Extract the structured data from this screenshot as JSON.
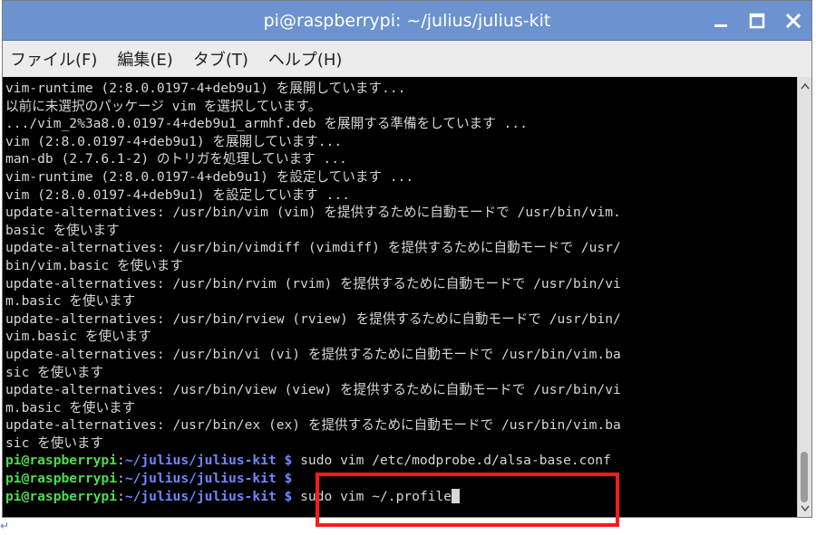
{
  "window": {
    "title": "pi@raspberrypi: ~/julius/julius-kit"
  },
  "window_controls": [
    {
      "name": "minimize-icon",
      "glyph": "minimize"
    },
    {
      "name": "maximize-icon",
      "glyph": "maximize"
    },
    {
      "name": "close-icon",
      "glyph": "close"
    }
  ],
  "menu": {
    "file": "ファイル(F)",
    "edit": "編集(E)",
    "tabs": "タブ(T)",
    "help": "ヘルプ(H)"
  },
  "terminal": {
    "output_lines": [
      "vim-runtime (2:8.0.0197-4+deb9u1) を展開しています...",
      "以前に未選択のパッケージ vim を選択しています。",
      ".../vim_2%3a8.0.0197-4+deb9u1_armhf.deb を展開する準備をしています ...",
      "vim (2:8.0.0197-4+deb9u1) を展開しています...",
      "man-db (2.7.6.1-2) のトリガを処理しています ...",
      "vim-runtime (2:8.0.0197-4+deb9u1) を設定しています ...",
      "vim (2:8.0.0197-4+deb9u1) を設定しています ...",
      "update-alternatives: /usr/bin/vim (vim) を提供するために自動モードで /usr/bin/vim.",
      "basic を使います",
      "update-alternatives: /usr/bin/vimdiff (vimdiff) を提供するために自動モードで /usr/",
      "bin/vim.basic を使います",
      "update-alternatives: /usr/bin/rvim (rvim) を提供するために自動モードで /usr/bin/vi",
      "m.basic を使います",
      "update-alternatives: /usr/bin/rview (rview) を提供するために自動モードで /usr/bin/",
      "vim.basic を使います",
      "update-alternatives: /usr/bin/vi (vi) を提供するために自動モードで /usr/bin/vim.ba",
      "sic を使います",
      "update-alternatives: /usr/bin/view (view) を提供するために自動モードで /usr/bin/vi",
      "m.basic を使います",
      "update-alternatives: /usr/bin/ex (ex) を提供するために自動モードで /usr/bin/vim.ba",
      "sic を使います"
    ],
    "prompt_user": "pi@raspberrypi",
    "prompt_colon": ":",
    "prompt_path": "~/julius/julius-kit",
    "prompt_dollar": "$",
    "commands": [
      "sudo vim /etc/modprobe.d/alsa-base.conf",
      "",
      "sudo vim ~/.profile"
    ]
  },
  "colors": {
    "titlebar": "#6c93cf",
    "terminal_bg": "#000000",
    "terminal_text": "#d6d6d6",
    "prompt_user": "#4fdc4f",
    "prompt_path": "#6f86ff",
    "highlight": "#ff1a1a"
  },
  "footer": {
    "return_mark": "↵"
  }
}
